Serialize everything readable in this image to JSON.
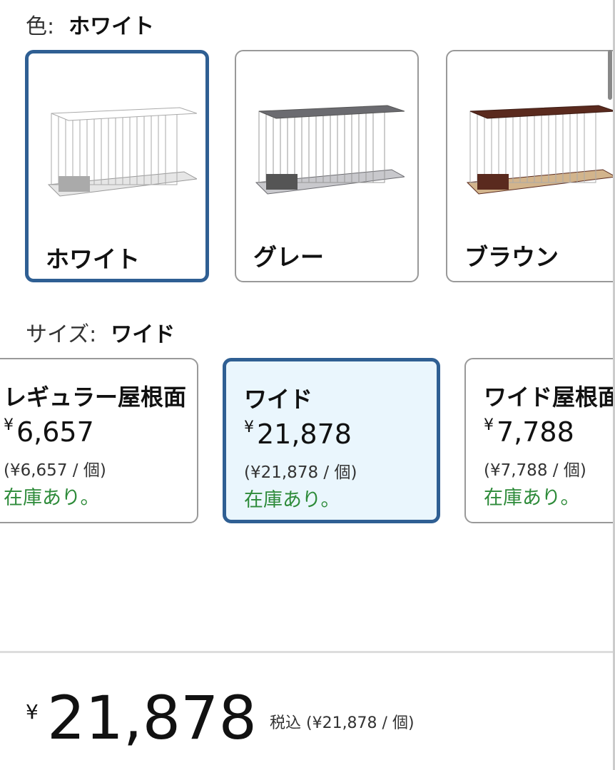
{
  "color": {
    "label": "色:",
    "selected": "ホワイト",
    "options": [
      {
        "name": "ホワイト",
        "frame": "#ffffff",
        "base": "#e6e6e6"
      },
      {
        "name": "グレー",
        "frame": "#6b6b70",
        "base": "#c8c8cc"
      },
      {
        "name": "ブラウン",
        "frame": "#5a2a1e",
        "base": "#d2b48c"
      }
    ]
  },
  "size": {
    "label": "サイズ:",
    "selected": "ワイド",
    "options": [
      {
        "title": "レギュラー屋根面",
        "price": "6,657",
        "unit": "(¥6,657 / 個)",
        "stock": "在庫あり。"
      },
      {
        "title": "ワイド",
        "price": "21,878",
        "unit": "(¥21,878 / 個)",
        "stock": "在庫あり。"
      },
      {
        "title": "ワイド屋根面",
        "price": "7,788",
        "unit": "(¥7,788 / 個)",
        "stock": "在庫あり。"
      }
    ],
    "currency": "¥"
  },
  "total": {
    "currency": "¥",
    "amount": "21,878",
    "tax": "税込 (¥21,878 / 個)"
  }
}
